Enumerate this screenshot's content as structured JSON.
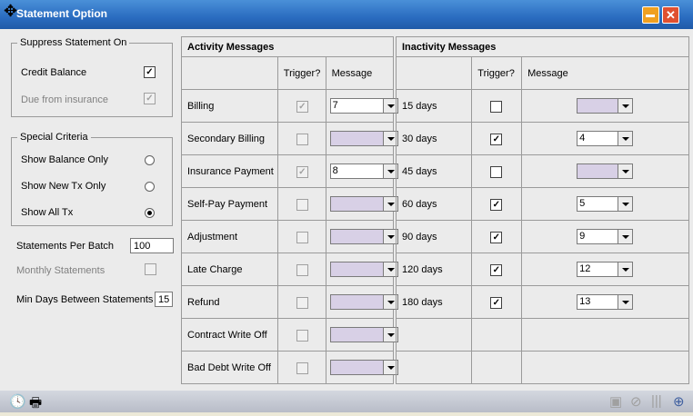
{
  "window": {
    "title": "Statement Option"
  },
  "suppress": {
    "legend": "Suppress Statement On",
    "credit_balance": "Credit Balance",
    "due_from_insurance": "Due from insurance"
  },
  "special": {
    "legend": "Special Criteria",
    "balance_only": "Show Balance Only",
    "new_tx_only": "Show New Tx Only",
    "all_tx": "Show All Tx"
  },
  "options": {
    "per_batch_label": "Statements Per Batch",
    "per_batch_value": "100",
    "monthly_label": "Monthly Statements",
    "min_days_label": "Min Days Between Statements",
    "min_days_value": "15"
  },
  "activity": {
    "title": "Activity Messages",
    "trigger_header": "Trigger?",
    "message_header": "Message",
    "rows": [
      {
        "label": "Billing",
        "trigger": true,
        "message": "7"
      },
      {
        "label": "Secondary Billing",
        "trigger": false,
        "message": ""
      },
      {
        "label": "Insurance Payment",
        "trigger": true,
        "message": "8"
      },
      {
        "label": "Self-Pay Payment",
        "trigger": false,
        "message": ""
      },
      {
        "label": "Adjustment",
        "trigger": false,
        "message": ""
      },
      {
        "label": "Late Charge",
        "trigger": false,
        "message": ""
      },
      {
        "label": "Refund",
        "trigger": false,
        "message": ""
      },
      {
        "label": "Contract Write Off",
        "trigger": false,
        "message": ""
      },
      {
        "label": "Bad Debt Write Off",
        "trigger": false,
        "message": ""
      }
    ]
  },
  "inactivity": {
    "title": "Inactivity Messages",
    "trigger_header": "Trigger?",
    "message_header": "Message",
    "rows": [
      {
        "label": "15 days",
        "trigger": false,
        "message": ""
      },
      {
        "label": "30 days",
        "trigger": true,
        "message": "4"
      },
      {
        "label": "45 days",
        "trigger": false,
        "message": ""
      },
      {
        "label": "60 days",
        "trigger": true,
        "message": "5"
      },
      {
        "label": "90 days",
        "trigger": true,
        "message": "9"
      },
      {
        "label": "120  days",
        "trigger": true,
        "message": "12"
      },
      {
        "label": "180  days",
        "trigger": true,
        "message": "13"
      }
    ]
  },
  "icons": [
    "clock-icon",
    "printer-icon",
    "save-icon",
    "cancel-icon",
    "grip-icon",
    "new-window-icon"
  ]
}
